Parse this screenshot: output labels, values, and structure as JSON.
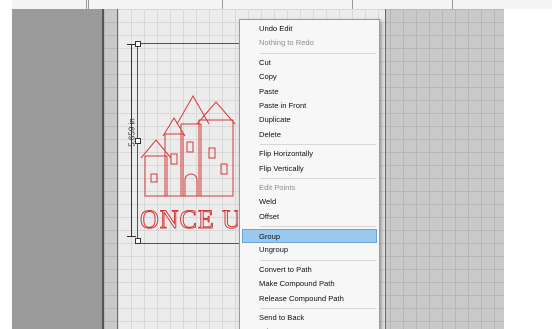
{
  "context_menu": {
    "groups": [
      [
        {
          "label": "Undo Edit",
          "enabled": true
        },
        {
          "label": "Nothing to Redo",
          "enabled": false
        }
      ],
      [
        {
          "label": "Cut",
          "enabled": true
        },
        {
          "label": "Copy",
          "enabled": true
        },
        {
          "label": "Paste",
          "enabled": true
        },
        {
          "label": "Paste in Front",
          "enabled": true
        },
        {
          "label": "Duplicate",
          "enabled": true
        },
        {
          "label": "Delete",
          "enabled": true
        }
      ],
      [
        {
          "label": "Flip Horizontally",
          "enabled": true
        },
        {
          "label": "Flip Vertically",
          "enabled": true
        }
      ],
      [
        {
          "label": "Edit Points",
          "enabled": false
        },
        {
          "label": "Weld",
          "enabled": true
        },
        {
          "label": "Offset",
          "enabled": true
        }
      ],
      [
        {
          "label": "Group",
          "enabled": true,
          "highlighted": true
        },
        {
          "label": "Ungroup",
          "enabled": true
        }
      ],
      [
        {
          "label": "Convert to Path",
          "enabled": true
        },
        {
          "label": "Make Compound Path",
          "enabled": true
        },
        {
          "label": "Release Compound Path",
          "enabled": true
        }
      ],
      [
        {
          "label": "Send to Back",
          "enabled": true
        },
        {
          "label": "Bring to Front",
          "enabled": true
        }
      ]
    ]
  },
  "canvas": {
    "dimension_label": "5.659 in",
    "artwork_text": "ONCE UPON",
    "colors": {
      "cut_line": "#d43a3a",
      "highlight": "#99c9ef",
      "mat": "#c9c9c9"
    }
  }
}
